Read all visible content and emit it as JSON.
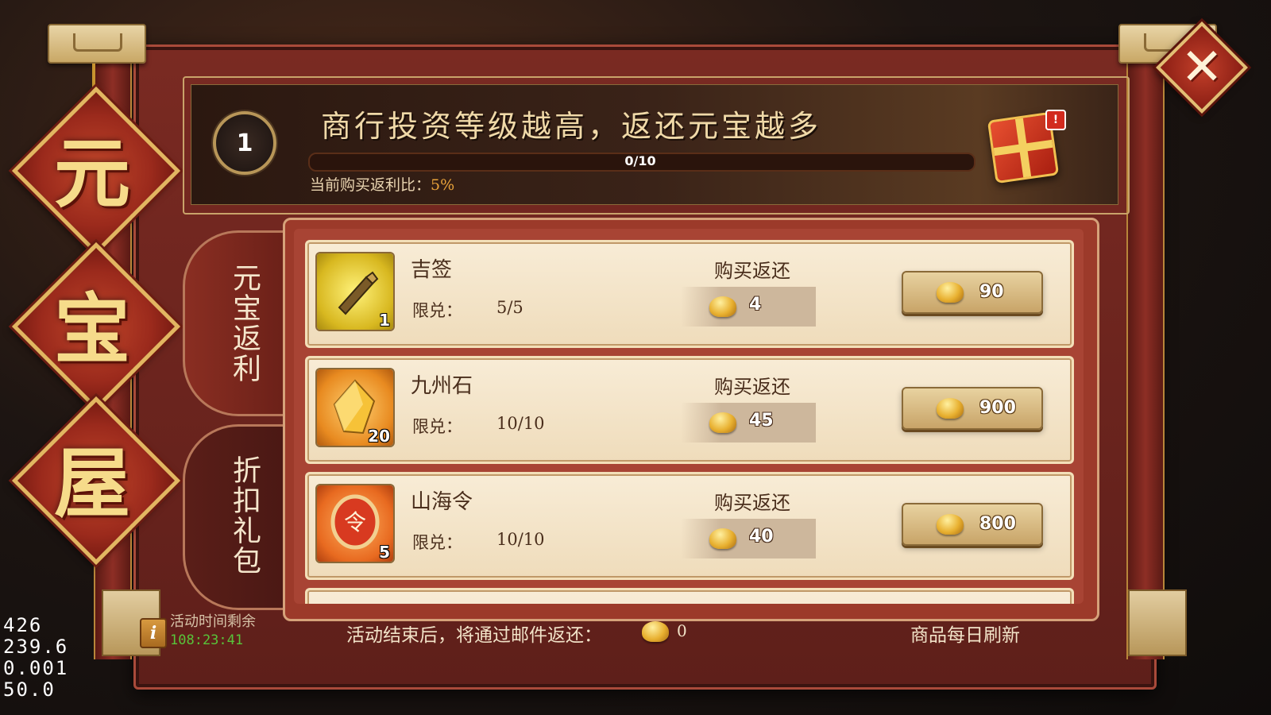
{
  "title_chars": [
    "元",
    "宝",
    "屋"
  ],
  "banner": {
    "level": "1",
    "title": "商行投资等级越高，返还元宝越多",
    "progress_text": "0/10",
    "progress_fraction": 0,
    "rate_label": "当前购买返利比：",
    "rate_value": "5%",
    "gift_badge": "!"
  },
  "tabs": [
    {
      "label": "元宝返利",
      "active": true
    },
    {
      "label": "折扣礼包",
      "active": false
    }
  ],
  "items": [
    {
      "name": "吉签",
      "icon": "scroll-icon",
      "count": "1",
      "limit_label": "限兑：",
      "limit": "5/5",
      "return_label": "购买返还",
      "return_amount": "4",
      "price": "90"
    },
    {
      "name": "九州石",
      "icon": "crystal-icon",
      "count": "20",
      "limit_label": "限兑：",
      "limit": "10/10",
      "return_label": "购买返还",
      "return_amount": "45",
      "price": "900"
    },
    {
      "name": "山海令",
      "icon": "token-icon",
      "count": "5",
      "limit_label": "限兑：",
      "limit": "10/10",
      "return_label": "购买返还",
      "return_amount": "40",
      "price": "800"
    }
  ],
  "footer": {
    "timer_label": "活动时间剩余",
    "timer_value": "108:23:41",
    "mail_text": "活动结束后，将通过邮件返还：",
    "mail_value": "0",
    "refresh_text": "商品每日刷新"
  },
  "debug_overlay": [
    "426",
    "239.6",
    "0.001",
    "50.0"
  ],
  "colors": {
    "accent": "#e8a23a",
    "timer": "#58c43a",
    "frame": "#7a2a22"
  }
}
